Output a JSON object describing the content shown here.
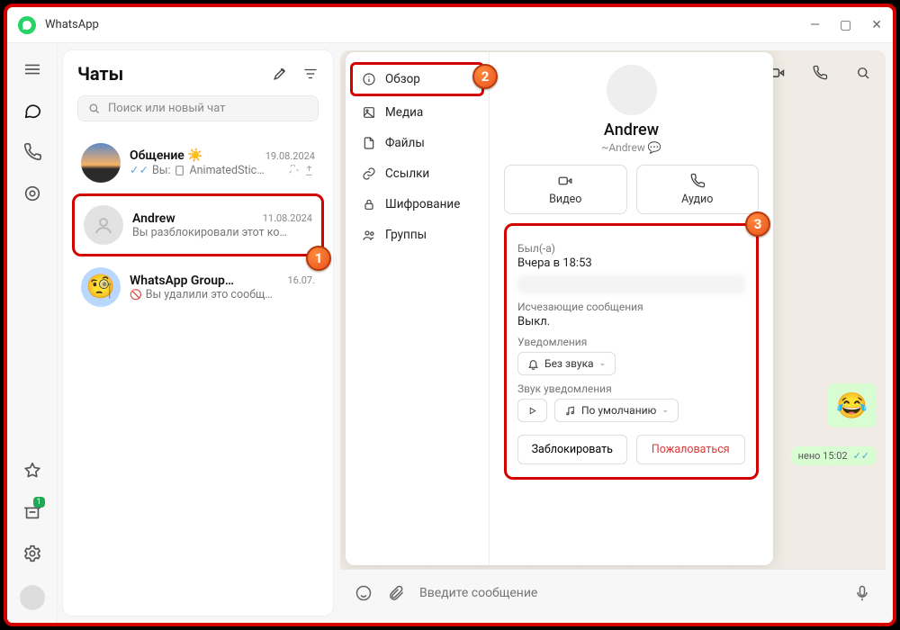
{
  "window": {
    "title": "WhatsApp"
  },
  "sidebar": {
    "title": "Чаты",
    "search_placeholder": "Поиск или новый чат"
  },
  "chats": [
    {
      "name": "Общение",
      "date": "19.08.2024",
      "preview_prefix": "Вы:",
      "preview": "AnimatedStic…",
      "sun": "☀️"
    },
    {
      "name": "Andrew",
      "date": "11.08.2024",
      "preview": "Вы разблокировали этот ко…"
    },
    {
      "name": "WhatsApp Group…",
      "date": "16.07.",
      "preview": "Вы удалили это сообщ…"
    }
  ],
  "info_nav": {
    "overview": "Обзор",
    "media": "Медиа",
    "files": "Файлы",
    "links": "Ссылки",
    "encryption": "Шифрование",
    "groups": "Группы"
  },
  "contact": {
    "name": "Andrew",
    "sub": "~Andrew 💬",
    "video": "Видео",
    "audio": "Аудио",
    "last_seen_label": "Был(-а)",
    "last_seen_value": "Вчера в 18:53",
    "disappearing_label": "Исчезающие сообщения",
    "disappearing_value": "Выкл.",
    "notifications_label": "Уведомления",
    "notifications_value": "Без звука",
    "sound_label": "Звук уведомления",
    "sound_value": "По умолчанию",
    "block": "Заблокировать",
    "report": "Пожаловаться"
  },
  "compose": {
    "placeholder": "Введите сообщение"
  },
  "peek": {
    "time": "нено 15:02",
    "emoji": "😂"
  },
  "anno": {
    "1": "1",
    "2": "2",
    "3": "3"
  }
}
